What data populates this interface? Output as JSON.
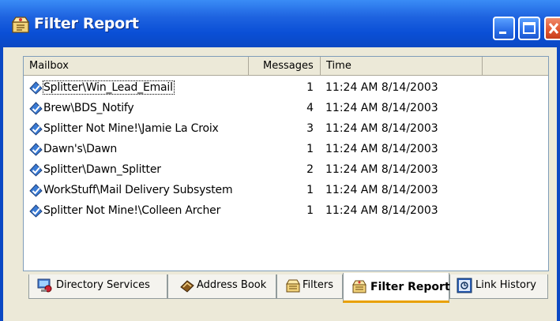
{
  "window": {
    "title": "Filter Report"
  },
  "list": {
    "columns": [
      "Mailbox",
      "Messages",
      "Time",
      ""
    ],
    "rows": [
      {
        "mailbox": "Splitter\\Win_Lead_Email",
        "messages": "1",
        "time": "11:24 AM 8/14/2003"
      },
      {
        "mailbox": "Brew\\BDS_Notify",
        "messages": "4",
        "time": "11:24 AM 8/14/2003"
      },
      {
        "mailbox": "Splitter Not Mine!\\Jamie La Croix",
        "messages": "3",
        "time": "11:24 AM 8/14/2003"
      },
      {
        "mailbox": "Dawn's\\Dawn",
        "messages": "1",
        "time": "11:24 AM 8/14/2003"
      },
      {
        "mailbox": "Splitter\\Dawn_Splitter",
        "messages": "2",
        "time": "11:24 AM 8/14/2003"
      },
      {
        "mailbox": "WorkStuff\\Mail Delivery Subsystem",
        "messages": "1",
        "time": "11:24 AM 8/14/2003"
      },
      {
        "mailbox": "Splitter Not Mine!\\Colleen Archer",
        "messages": "1",
        "time": "11:24 AM 8/14/2003"
      }
    ]
  },
  "tabs": [
    {
      "label": "Directory Services",
      "icon": "directory-icon"
    },
    {
      "label": "Address Book",
      "icon": "address-book-icon"
    },
    {
      "label": "Filters",
      "icon": "filters-icon"
    },
    {
      "label": "Filter Report",
      "icon": "filter-report-icon",
      "active": true
    },
    {
      "label": "Link History",
      "icon": "link-history-icon"
    }
  ],
  "colors": {
    "titlebar": "#0b48c4",
    "tab_active_accent": "#e8a000",
    "close_button": "#e0552f"
  }
}
